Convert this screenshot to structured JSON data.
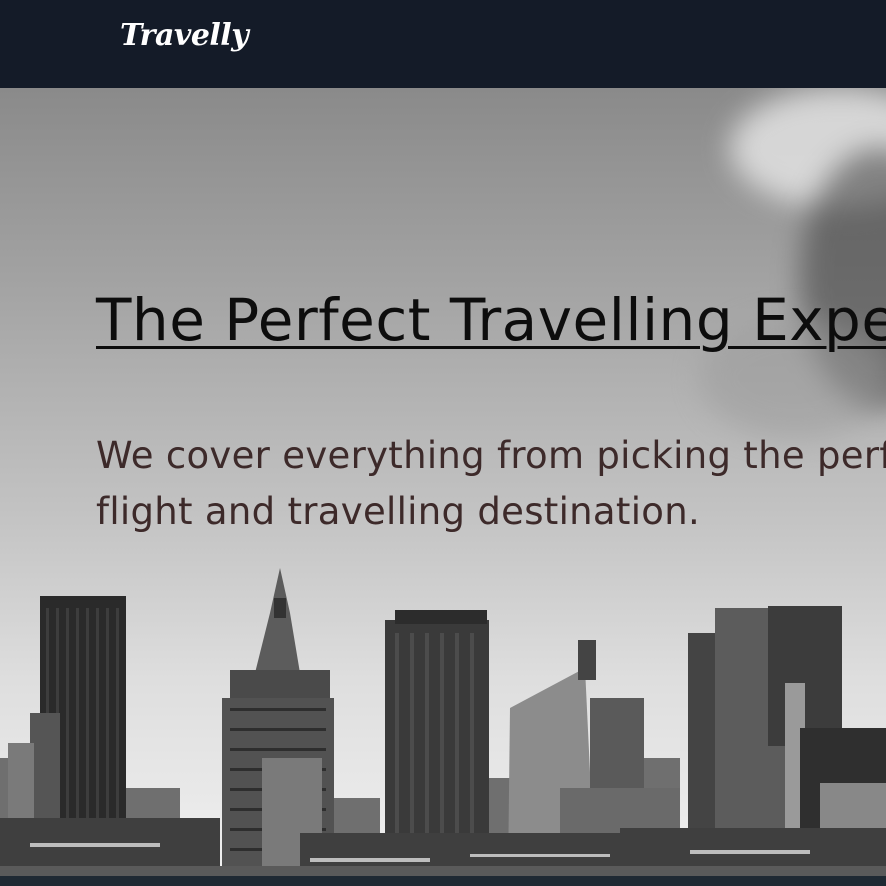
{
  "nav": {
    "brand": "Travelly"
  },
  "hero": {
    "title": "The Perfect Travelling Experience",
    "text": "We cover everything from picking the perfect flight and travelling destination."
  },
  "icons": {
    "skyline": "city-skyline-image"
  },
  "colors": {
    "navbar": "#141b28",
    "title": "#0d0d0d",
    "text": "#3d2a2a"
  }
}
